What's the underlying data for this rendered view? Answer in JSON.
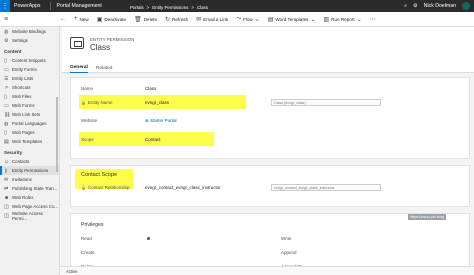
{
  "topbar": {
    "brand": "PowerApps",
    "app_name": "Portal Management",
    "breadcrumb": [
      "Portals",
      "Entity Permissions",
      "Class"
    ],
    "user": "Nick Doelman"
  },
  "commands": [
    {
      "icon": "plus-icon",
      "label": "New"
    },
    {
      "icon": "deactivate-icon",
      "label": "Deactivate"
    },
    {
      "icon": "delete-icon",
      "label": "Delete"
    },
    {
      "icon": "refresh-icon",
      "label": "Refresh"
    },
    {
      "icon": "email-icon",
      "label": "Email a Link"
    },
    {
      "icon": "flow-icon",
      "label": "Flow"
    },
    {
      "icon": "word-icon",
      "label": "Word Templates"
    },
    {
      "icon": "report-icon",
      "label": "Run Report"
    }
  ],
  "sidebar": {
    "top_items": [
      {
        "icon": "globe-icon",
        "label": "Website Bindings"
      },
      {
        "icon": "gear-icon",
        "label": "Settings"
      }
    ],
    "content_heading": "Content",
    "content_items": [
      {
        "icon": "doc-icon",
        "label": "Content Snippets"
      },
      {
        "icon": "form-icon",
        "label": "Entity Forms"
      },
      {
        "icon": "list-icon",
        "label": "Entity Lists"
      },
      {
        "icon": "shortcut-icon",
        "label": "Shortcuts"
      },
      {
        "icon": "file-icon",
        "label": "Web Files"
      },
      {
        "icon": "form-icon",
        "label": "Web Forms"
      },
      {
        "icon": "link-icon",
        "label": "Web Link Sets"
      },
      {
        "icon": "globe-icon",
        "label": "Portal Languages"
      },
      {
        "icon": "page-icon",
        "label": "Web Pages"
      },
      {
        "icon": "template-icon",
        "label": "Web Templates"
      }
    ],
    "security_heading": "Security",
    "security_items": [
      {
        "icon": "contact-icon",
        "label": "Contacts",
        "active": false
      },
      {
        "icon": "key-icon",
        "label": "Entity Permissions",
        "active": true
      },
      {
        "icon": "mail-icon",
        "label": "Invitations",
        "active": false
      },
      {
        "icon": "workflow-icon",
        "label": "Publishing State Tran...",
        "active": false
      },
      {
        "icon": "role-icon",
        "label": "Web Roles",
        "active": false
      },
      {
        "icon": "web-icon",
        "label": "Web Page Access Co...",
        "active": false
      },
      {
        "icon": "web-icon",
        "label": "Website Access Permi...",
        "active": false
      }
    ]
  },
  "form": {
    "entity_type": "ENTITY PERMISSION",
    "record_name": "Class",
    "tabs": [
      {
        "label": "General",
        "active": true
      },
      {
        "label": "Related",
        "active": false
      }
    ],
    "fields": {
      "name_label": "Name",
      "name_value": "Class",
      "entity_name_label": "Entity Name",
      "entity_name_value": "evngr_class",
      "entity_name_side": "Class (evngr_class)",
      "website_label": "Website",
      "website_value": "Starter Portal",
      "scope_label": "Scope",
      "scope_value": "Contact"
    },
    "contact_scope": {
      "title": "Contact Scope",
      "relationship_label": "Contact Relationship",
      "relationship_value": "evngr_contact_evngr_class_instructor",
      "relationship_side": "evngr_contact_evngr_class_instructor"
    },
    "privileges": {
      "title": "Privileges",
      "items_left": [
        {
          "label": "Read",
          "checked": true
        },
        {
          "label": "Create",
          "checked": false
        },
        {
          "label": "Delete",
          "checked": false
        }
      ],
      "items_right": [
        {
          "label": "Write",
          "checked": false
        },
        {
          "label": "Append",
          "checked": false
        },
        {
          "label": "Append To",
          "checked": false
        }
      ]
    },
    "watermark": "https://nsup.plo.blog"
  },
  "status": {
    "text": "Active"
  },
  "colors": {
    "highlight": "#fbfb2a",
    "accent": "#0078d4",
    "topbar": "#2b2b2b"
  }
}
